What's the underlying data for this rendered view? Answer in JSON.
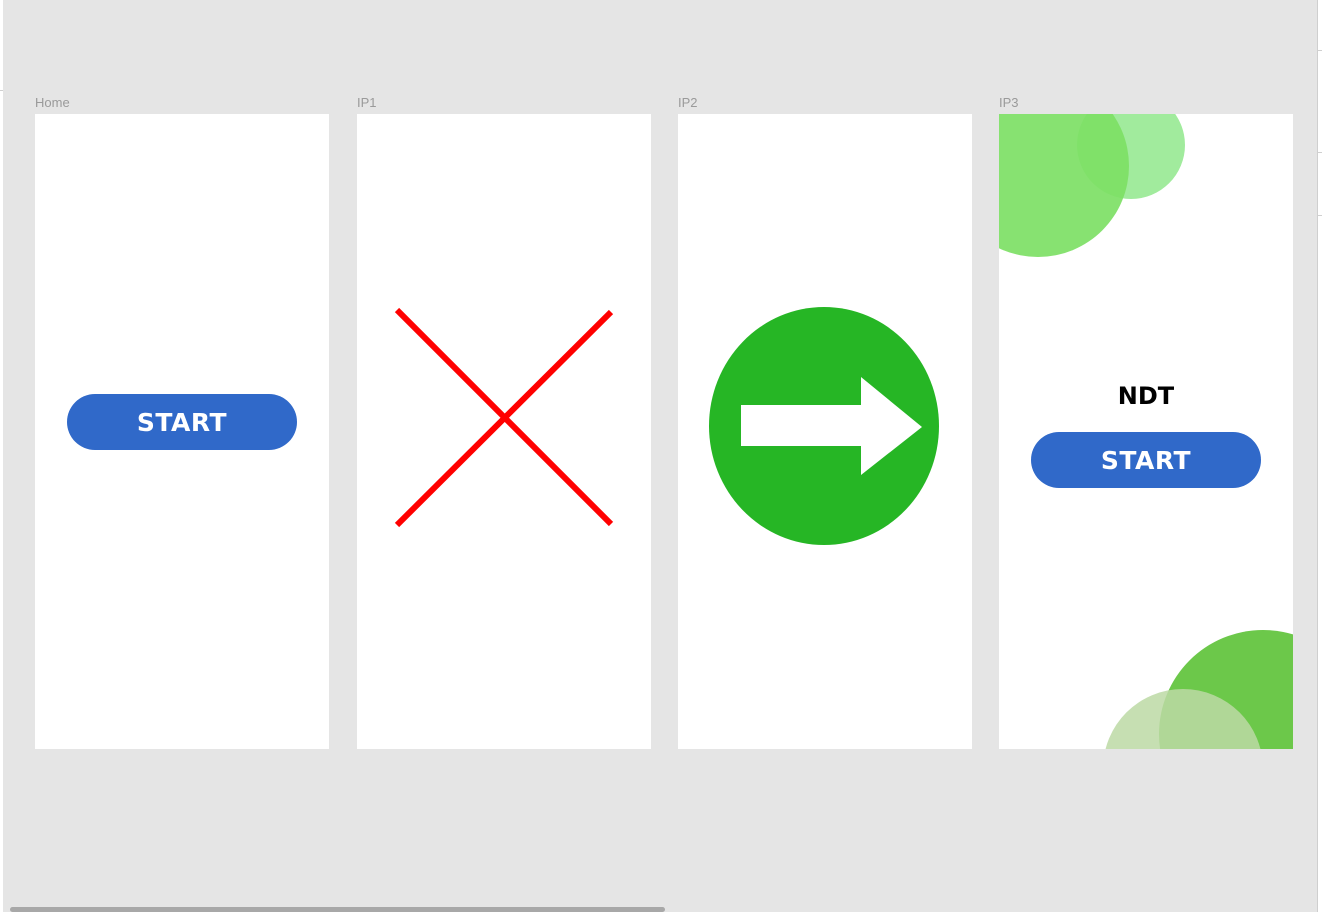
{
  "artboards": [
    {
      "label": "Home"
    },
    {
      "label": "IP1"
    },
    {
      "label": "IP2"
    },
    {
      "label": "IP3"
    }
  ],
  "home": {
    "start_label": "START"
  },
  "ip1": {
    "icon": "close-icon",
    "color": "#ff0000"
  },
  "ip2": {
    "icon": "arrow-right-icon",
    "color": "#26b625"
  },
  "ip3": {
    "title": "NDT",
    "start_label": "START",
    "decoration_colors": [
      "#7ddf65",
      "#a1eb9d",
      "#6cc84a",
      "#bcd9a4"
    ]
  },
  "colors": {
    "canvas": "#e5e5e5",
    "artboard": "#ffffff",
    "button": "#3069c9",
    "button_text": "#ffffff"
  }
}
